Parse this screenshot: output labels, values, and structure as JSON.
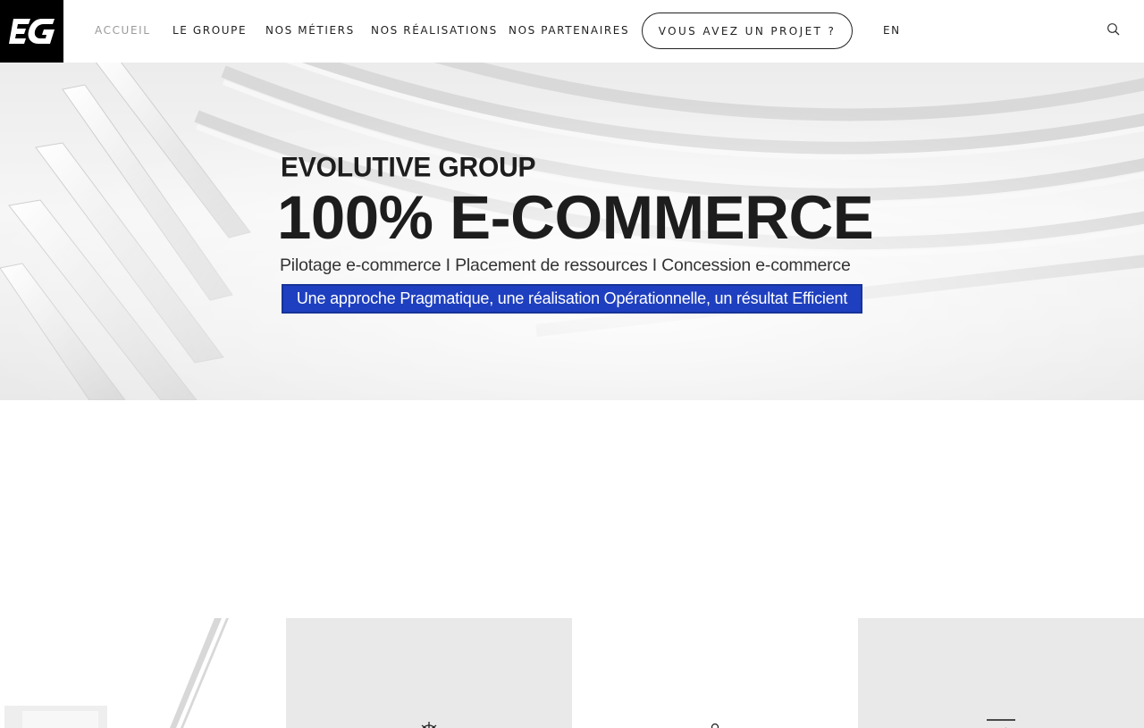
{
  "header": {
    "logo_text": "EG",
    "nav": [
      {
        "label": "ACCUEIL",
        "active": true
      },
      {
        "label": "LE GROUPE",
        "active": false
      },
      {
        "label": "NOS MÉTIERS",
        "active": false
      },
      {
        "label": "NOS RÉALISATIONS",
        "active": false
      },
      {
        "label": "NOS PARTENAIRES",
        "active": false
      }
    ],
    "cta_label": "VOUS AVEZ UN PROJET ?",
    "language_label": "EN",
    "search_icon": "search-icon"
  },
  "hero": {
    "title_small": "EVOLUTIVE GROUP",
    "title_big": "100% E-COMMERCE",
    "subtitle": "Pilotage e-commerce I Placement de ressources I Concession e-commerce",
    "banner": "Une approche Pragmatique, une réalisation Opérationnelle, un résultat Efficient",
    "banner_color": "#1e3fbf"
  },
  "tiles": [
    {
      "icon": "laptop-photo"
    },
    {
      "icon": "ship-wheel-icon"
    },
    {
      "icon": "person-icon"
    },
    {
      "icon": "presentation-board-icon"
    }
  ]
}
